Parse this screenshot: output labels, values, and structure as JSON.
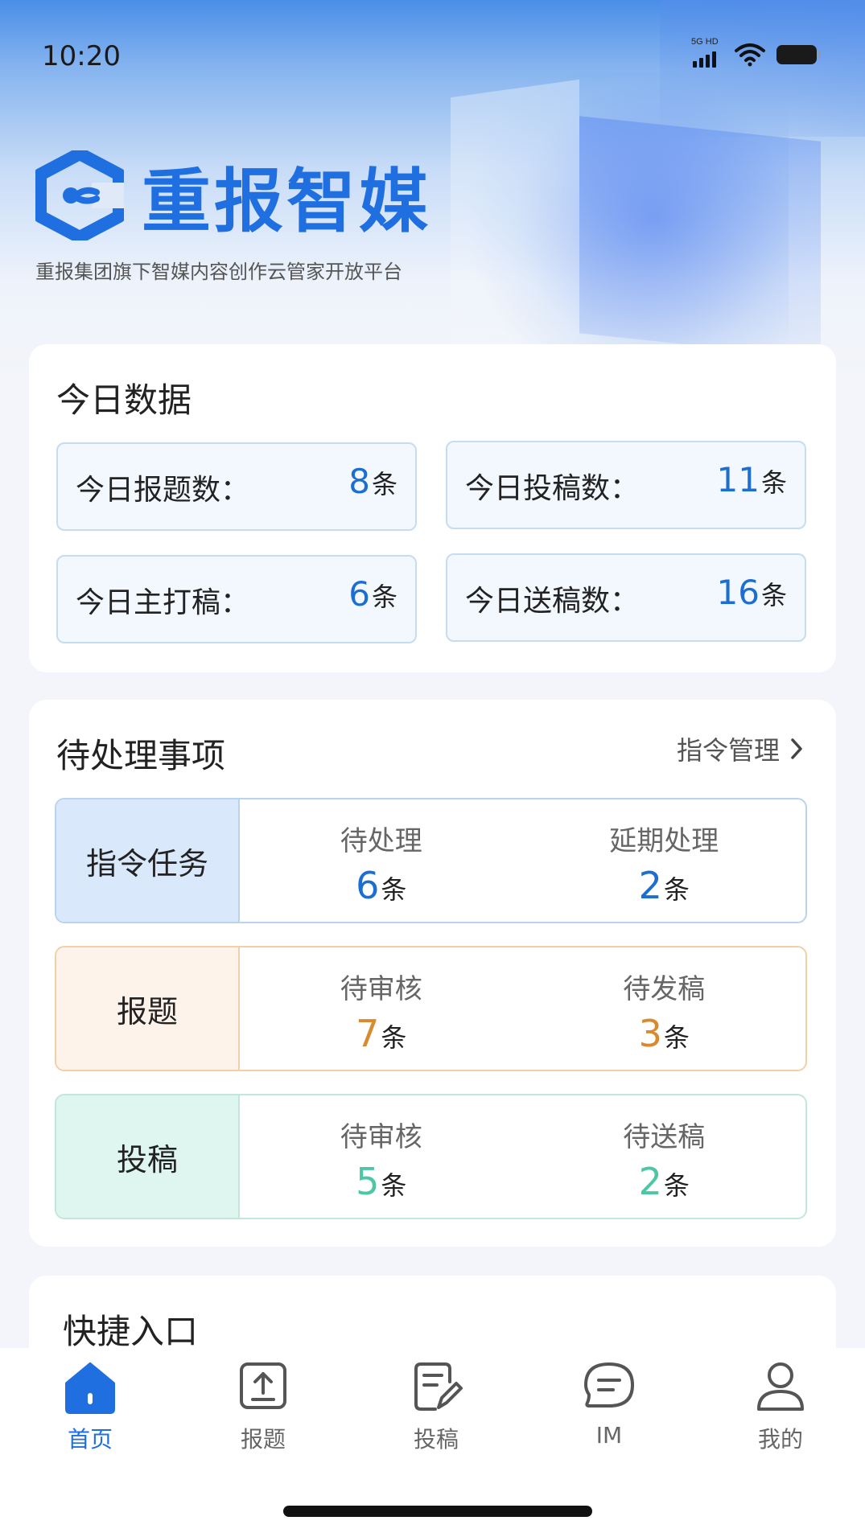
{
  "status_bar": {
    "time": "10:20",
    "network": "5G",
    "hd": "HD"
  },
  "brand": {
    "name": "重报智媒",
    "subtitle": "重报集团旗下智媒内容创作云管家开放平台",
    "color": "#1f6fe0"
  },
  "today": {
    "title": "今日数据",
    "stats": [
      {
        "label": "今日报题数：",
        "value": "8",
        "unit": "条"
      },
      {
        "label": "今日投稿数：",
        "value": "11",
        "unit": "条"
      },
      {
        "label": "今日主打稿：",
        "value": "6",
        "unit": "条"
      },
      {
        "label": "今日送稿数：",
        "value": "16",
        "unit": "条"
      }
    ]
  },
  "pending": {
    "title": "待处理事项",
    "link": "指令管理",
    "rows": [
      {
        "tag": "指令任务",
        "items": [
          {
            "label": "待处理",
            "value": "6",
            "unit": "条"
          },
          {
            "label": "延期处理",
            "value": "2",
            "unit": "条"
          }
        ]
      },
      {
        "tag": "报题",
        "items": [
          {
            "label": "待审核",
            "value": "7",
            "unit": "条"
          },
          {
            "label": "待发稿",
            "value": "3",
            "unit": "条"
          }
        ]
      },
      {
        "tag": "投稿",
        "items": [
          {
            "label": "待审核",
            "value": "5",
            "unit": "条"
          },
          {
            "label": "待送稿",
            "value": "2",
            "unit": "条"
          }
        ]
      }
    ]
  },
  "shortcuts": {
    "title": "快捷入口"
  },
  "tabbar": [
    {
      "label": "首页",
      "icon": "home-icon",
      "active": true
    },
    {
      "label": "报题",
      "icon": "upload-icon"
    },
    {
      "label": "投稿",
      "icon": "edit-doc-icon"
    },
    {
      "label": "IM",
      "icon": "chat-icon"
    },
    {
      "label": "我的",
      "icon": "user-icon"
    }
  ],
  "colors": {
    "accent_blue": "#1c6fd1",
    "orange": "#d88a2d",
    "green": "#4cc7a5"
  }
}
